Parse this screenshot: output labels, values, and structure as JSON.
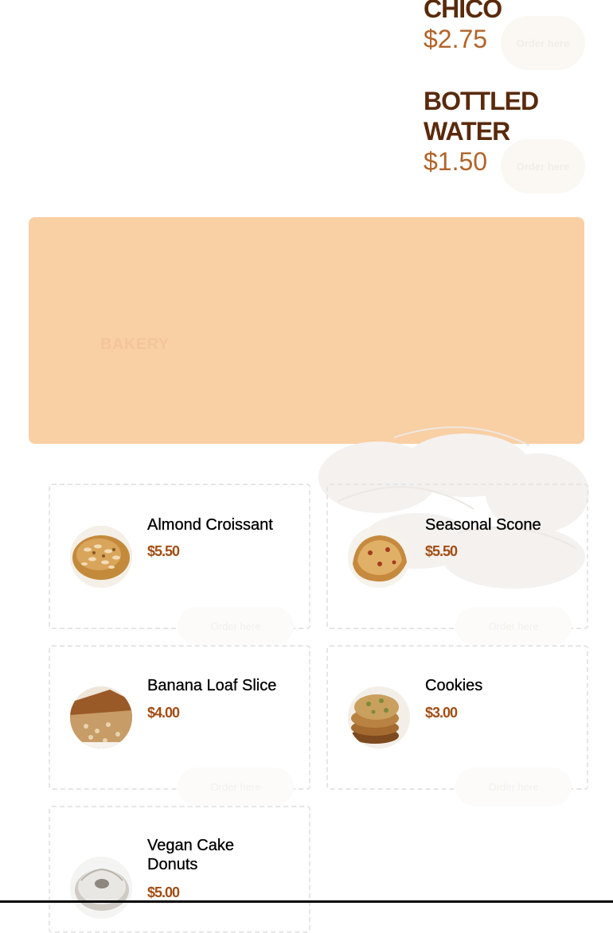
{
  "drinks": [
    {
      "name": "CHICO",
      "price": "$2.75",
      "button": "Order here"
    },
    {
      "name": "BOTTLED WATER",
      "price": "$1.50",
      "button": "Order here"
    }
  ],
  "bakery": {
    "title": "BAKERY",
    "items": [
      {
        "name": "Almond Croissant",
        "price": "$5.50",
        "button": "Order here",
        "icon": "croissant-photo"
      },
      {
        "name": "Seasonal Scone",
        "price": "$5.50",
        "button": "Order here",
        "icon": "scone-photo"
      },
      {
        "name": "Banana Loaf Slice",
        "price": "$4.00",
        "button": "Order here",
        "icon": "banana-loaf-photo"
      },
      {
        "name": "Cookies",
        "price": "$3.00",
        "button": "Order here",
        "icon": "cookies-photo"
      },
      {
        "name": "Vegan Cake Donuts",
        "price": "$5.00",
        "button": "Order here",
        "icon": "donut-photo"
      }
    ]
  },
  "colors": {
    "heading": "#5a2a0c",
    "price": "#b0642a",
    "item_price": "#a24d14",
    "banner": "#f9cfa4"
  }
}
